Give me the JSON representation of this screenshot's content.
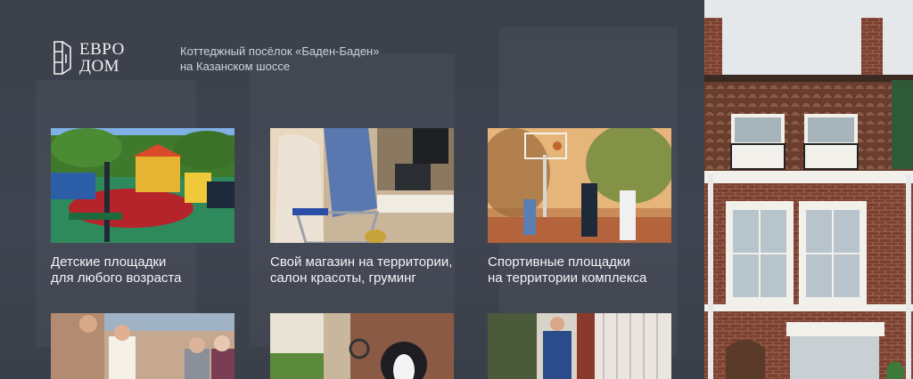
{
  "logo": {
    "line1": "ЕВРО",
    "line2": "ДОМ"
  },
  "tagline": {
    "line1": "Коттеджный посёлок «Баден-Баден»",
    "line2": "на Казанском шоссе"
  },
  "features": [
    {
      "line1": "Детские площадки",
      "line2": "для любого возраста"
    },
    {
      "line1": "Свой магазин на территории,",
      "line2": "салон красоты, груминг"
    },
    {
      "line1": "Спортивные площадки",
      "line2": "на территории комплекса"
    }
  ],
  "colors": {
    "background": "#3d424d",
    "text": "#eef0f3",
    "brick": "#7b3f2e",
    "trim": "#f2f0ea"
  }
}
